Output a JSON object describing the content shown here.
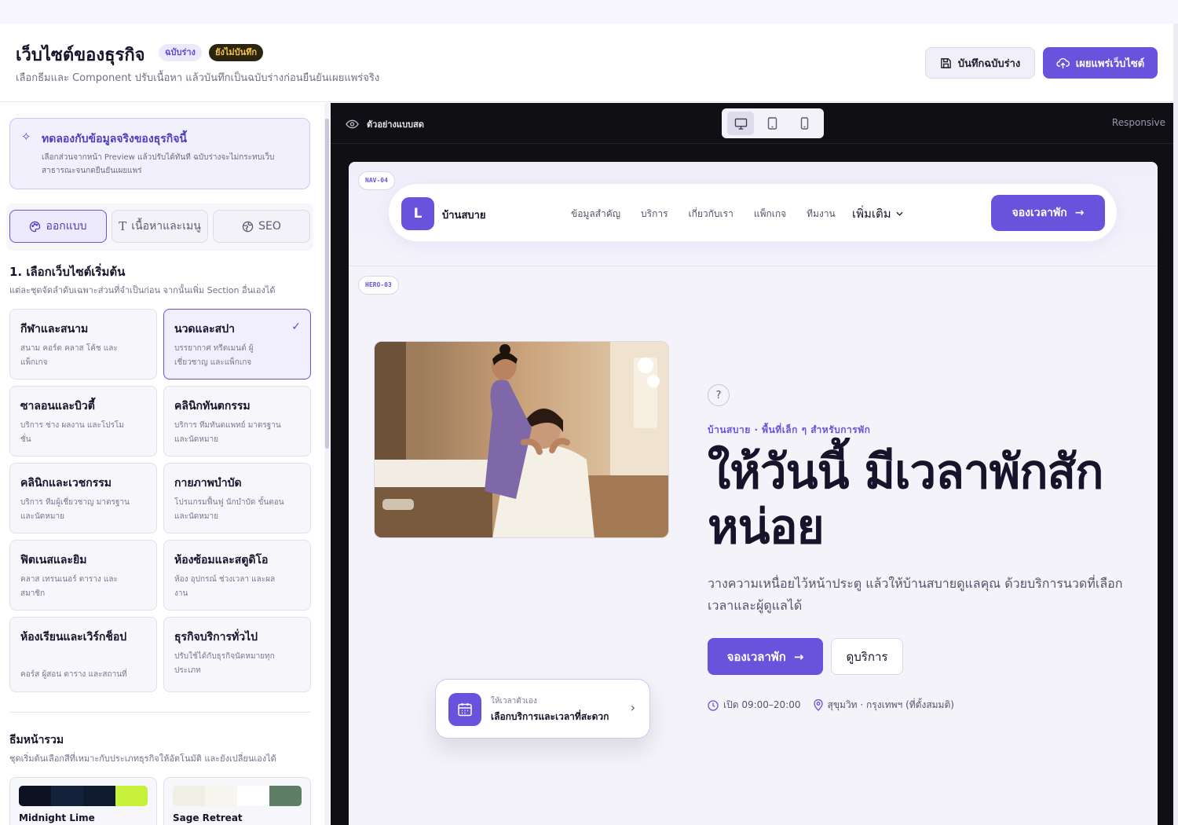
{
  "header": {
    "title": "เว็บไซต์ของธุรกิจ",
    "badge_draft": "ฉบับร่าง",
    "badge_unsaved": "ยังไม่บันทึก",
    "subtitle": "เลือกธีมและ Component ปรับเนื้อหา แล้วบันทึกเป็นฉบับร่างก่อนยืนยันเผยแพร่จริง",
    "save_label": "บันทึกฉบับร่าง",
    "publish_label": "เผยแพร่เว็บไซต์"
  },
  "sidebar": {
    "try_card": {
      "title": "ทดลองกับข้อมูลจริงของธุรกิจนี้",
      "desc": "เลือกส่วนจากหน้า Preview แล้วปรับได้ทันที ฉบับร่างจะไม่กระทบเว็บสาธารณะจนกดยืนยันเผยแพร่"
    },
    "tabs": [
      {
        "label": "ออกแบบ",
        "icon": "palette-icon"
      },
      {
        "label": "เนื้อหาและเมนู",
        "icon": "text-icon"
      },
      {
        "label": "SEO",
        "icon": "globe-icon"
      }
    ],
    "section_title": "1. เลือกเว็บไซต์เริ่มต้น",
    "section_sub": "แต่ละชุดจัดลำดับเฉพาะส่วนที่จำเป็นก่อน จากนั้นเพิ่ม Section อื่นเองได้",
    "templates": [
      {
        "title": "กีฬาและสนาม",
        "desc": "สนาม คอร์ต คลาส โค้ช และแพ็กเกจ"
      },
      {
        "title": "นวดและสปา",
        "desc": "บรรยากาศ ทรีตเมนต์ ผู้เชี่ยวชาญ และแพ็กเกจ"
      },
      {
        "title": "ซาลอนและบิวตี้",
        "desc": "บริการ ช่าง ผลงาน และโปรโมชั่น"
      },
      {
        "title": "คลินิกทันตกรรม",
        "desc": "บริการ ทีมทันตแพทย์ มาตรฐาน และนัดหมาย"
      },
      {
        "title": "คลินิกและเวชกรรม",
        "desc": "บริการ ทีมผู้เชี่ยวชาญ มาตรฐาน และนัดหมาย"
      },
      {
        "title": "กายภาพบำบัด",
        "desc": "โปรแกรมฟื้นฟู นักบำบัด ขั้นตอน และนัดหมาย"
      },
      {
        "title": "ฟิตเนสและยิม",
        "desc": "คลาส เทรนเนอร์ ตาราง และสมาชิก"
      },
      {
        "title": "ห้องซ้อมและสตูดิโอ",
        "desc": "ห้อง อุปกรณ์ ช่วงเวลา และผลงาน"
      },
      {
        "title": "ห้องเรียนและเวิร์กช็อป",
        "desc": "คอร์ส ผู้สอน ตาราง และสถานที่"
      },
      {
        "title": "ธุรกิจบริการทั่วไป",
        "desc": "ปรับใช้ได้กับธุรกิจนัดหมายทุกประเภท"
      }
    ],
    "selected_template_index": 1,
    "theme_title": "ธีมหน้ารวม",
    "theme_sub": "ชุดเริ่มต้นเลือกสีที่เหมาะกับประเภทธุรกิจให้อัตโนมัติ และยังเปลี่ยนเองได้",
    "themes": [
      {
        "name": "Midnight Lime",
        "colors": [
          "#0c1222",
          "#14213a",
          "#101a2e",
          "#c7f03a"
        ]
      },
      {
        "name": "Sage Retreat",
        "colors": [
          "#f0efe6",
          "#f7f6ee",
          "#ffffff",
          "#5e7e66"
        ]
      }
    ]
  },
  "preview": {
    "live_label": "ตัวอย่างแบบสด",
    "responsive_label": "Responsive",
    "devices": [
      "desktop-icon",
      "tablet-icon",
      "mobile-icon"
    ],
    "nav_tag": "NAV-04",
    "hero_tag": "HERO-03",
    "brand_initial": "L",
    "brand_name": "บ้านสบาย",
    "nav_links": [
      "ข้อมูลสำคัญ",
      "บริการ",
      "เกี่ยวกับเรา",
      "แพ็กเกจ",
      "ทีมงาน"
    ],
    "nav_more": "เพิ่มเติม",
    "nav_cta": "จองเวลาพัก",
    "eyebrow": "บ้านสบาย · พื้นที่เล็ก ๆ สำหรับการพัก",
    "headline": "ให้วันนี้ มีเวลาพักสักหน่อย",
    "description": "วางความเหนื่อยไว้หน้าประตู แล้วให้บ้านสบายดูแลคุณ ด้วยบริการนวดที่เลือกเวลาและผู้ดูแลได้",
    "primary_cta": "จองเวลาพัก",
    "secondary_cta": "ดูบริการ",
    "hours": "เปิด 09:00–20:00",
    "location": "สุขุมวิท · กรุงเทพฯ (ที่ตั้งสมมติ)",
    "float_card": {
      "small": "ให้เวลาตัวเอง",
      "main": "เลือกบริการและเวลาที่สะดวก"
    }
  },
  "colors": {
    "accent": "#6a53dc",
    "ink": "#15142a",
    "preview_bg": "#0f0f14"
  }
}
